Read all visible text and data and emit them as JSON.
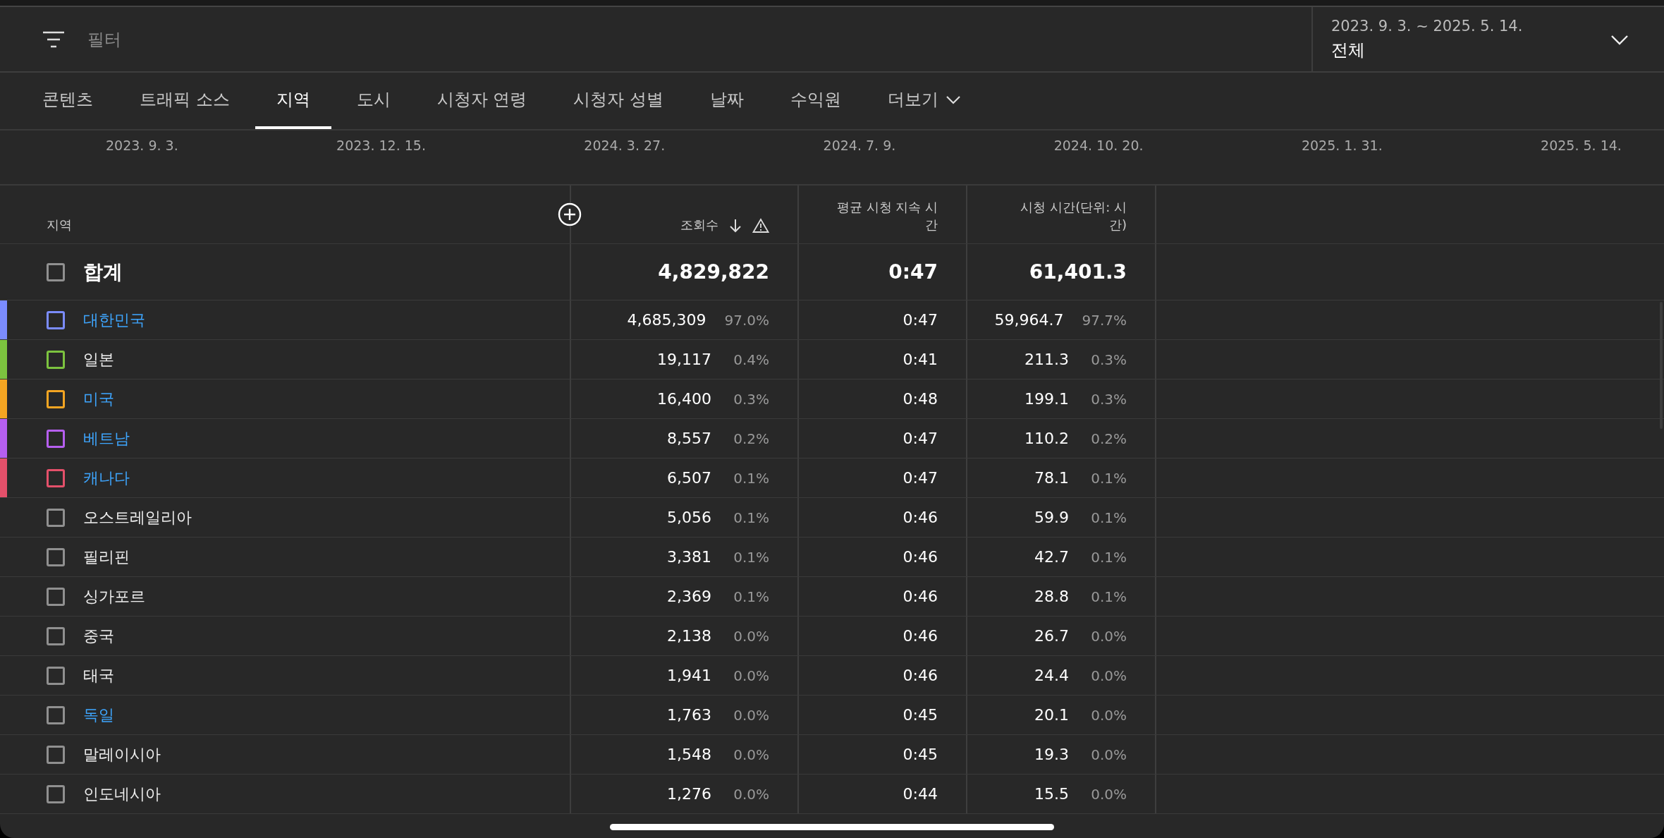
{
  "filter": {
    "placeholder": "필터"
  },
  "date_range": {
    "range": "2023. 9. 3. ~ 2025. 5. 14.",
    "label": "전체"
  },
  "tabs": [
    {
      "label": "콘텐츠",
      "selected": false
    },
    {
      "label": "트래픽 소스",
      "selected": false
    },
    {
      "label": "지역",
      "selected": true
    },
    {
      "label": "도시",
      "selected": false
    },
    {
      "label": "시청자 연령",
      "selected": false
    },
    {
      "label": "시청자 성별",
      "selected": false
    },
    {
      "label": "날짜",
      "selected": false
    },
    {
      "label": "수익원",
      "selected": false
    }
  ],
  "more_tab": {
    "label": "더보기"
  },
  "timeline": [
    "2023. 9. 3.",
    "2023. 12. 15.",
    "2024. 3. 27.",
    "2024. 7. 9.",
    "2024. 10. 20.",
    "2025. 1. 31.",
    "2025. 5. 14."
  ],
  "table": {
    "columns": [
      "지역",
      "조회수",
      "평균 시청 지속 시간",
      "시청 시간(단위: 시간)"
    ],
    "total": {
      "label": "합계",
      "checked": false,
      "views": "4,829,822",
      "avg": "0:47",
      "watch": "61,401.3"
    },
    "rows": [
      {
        "name": "대한민국",
        "link": true,
        "checked": false,
        "color": "#7b8cff",
        "views": "4,685,309",
        "views_pct": "97.0%",
        "avg": "0:47",
        "watch": "59,964.7",
        "watch_pct": "97.7%"
      },
      {
        "name": "일본",
        "link": false,
        "checked": false,
        "color": "#7cc33f",
        "views": "19,117",
        "views_pct": "0.4%",
        "avg": "0:41",
        "watch": "211.3",
        "watch_pct": "0.3%"
      },
      {
        "name": "미국",
        "link": true,
        "checked": false,
        "color": "#f4a522",
        "views": "16,400",
        "views_pct": "0.3%",
        "avg": "0:48",
        "watch": "199.1",
        "watch_pct": "0.3%"
      },
      {
        "name": "베트남",
        "link": true,
        "checked": false,
        "color": "#b65ff0",
        "views": "8,557",
        "views_pct": "0.2%",
        "avg": "0:47",
        "watch": "110.2",
        "watch_pct": "0.2%"
      },
      {
        "name": "캐나다",
        "link": true,
        "checked": false,
        "color": "#e4506a",
        "views": "6,507",
        "views_pct": "0.1%",
        "avg": "0:47",
        "watch": "78.1",
        "watch_pct": "0.1%"
      },
      {
        "name": "오스트레일리아",
        "link": false,
        "checked": false,
        "views": "5,056",
        "views_pct": "0.1%",
        "avg": "0:46",
        "watch": "59.9",
        "watch_pct": "0.1%"
      },
      {
        "name": "필리핀",
        "link": false,
        "checked": false,
        "views": "3,381",
        "views_pct": "0.1%",
        "avg": "0:46",
        "watch": "42.7",
        "watch_pct": "0.1%"
      },
      {
        "name": "싱가포르",
        "link": false,
        "checked": false,
        "views": "2,369",
        "views_pct": "0.1%",
        "avg": "0:46",
        "watch": "28.8",
        "watch_pct": "0.1%"
      },
      {
        "name": "중국",
        "link": false,
        "checked": false,
        "views": "2,138",
        "views_pct": "0.0%",
        "avg": "0:46",
        "watch": "26.7",
        "watch_pct": "0.0%"
      },
      {
        "name": "태국",
        "link": false,
        "checked": false,
        "views": "1,941",
        "views_pct": "0.0%",
        "avg": "0:46",
        "watch": "24.4",
        "watch_pct": "0.0%"
      },
      {
        "name": "독일",
        "link": true,
        "checked": false,
        "views": "1,763",
        "views_pct": "0.0%",
        "avg": "0:45",
        "watch": "20.1",
        "watch_pct": "0.0%"
      },
      {
        "name": "말레이시아",
        "link": false,
        "checked": false,
        "views": "1,548",
        "views_pct": "0.0%",
        "avg": "0:45",
        "watch": "19.3",
        "watch_pct": "0.0%"
      },
      {
        "name": "인도네시아",
        "link": false,
        "checked": false,
        "views": "1,276",
        "views_pct": "0.0%",
        "avg": "0:44",
        "watch": "15.5",
        "watch_pct": "0.0%"
      }
    ]
  }
}
